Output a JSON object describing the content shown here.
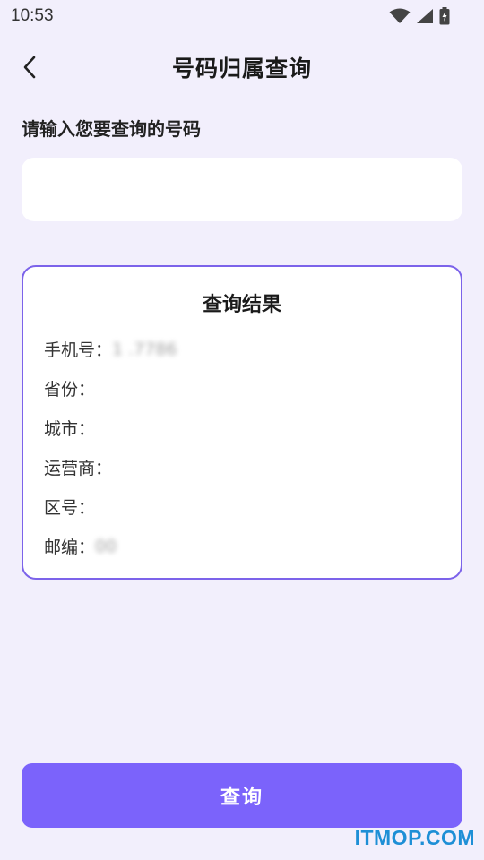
{
  "status_bar": {
    "time": "10:53"
  },
  "header": {
    "title": "号码归属查询"
  },
  "input": {
    "label": "请输入您要查询的号码",
    "value": "",
    "placeholder": ""
  },
  "result": {
    "title": "查询结果",
    "rows": [
      {
        "label": "手机号：",
        "value": "1      .7786"
      },
      {
        "label": "省份：",
        "value": ""
      },
      {
        "label": "城市：",
        "value": ""
      },
      {
        "label": "运营商：",
        "value": ""
      },
      {
        "label": "区号：",
        "value": ""
      },
      {
        "label": "邮编：",
        "value": "      00"
      }
    ]
  },
  "query_button": {
    "label": "查询"
  },
  "watermark": {
    "text": "ITMOP.COM"
  },
  "colors": {
    "background": "#f2effc",
    "accent": "#7b63fb",
    "card_border": "#7c63ea",
    "watermark": "#1e8fd6"
  },
  "icons": [
    "wifi-icon",
    "cell-signal-icon",
    "battery-charging-icon",
    "back-arrow-icon"
  ]
}
